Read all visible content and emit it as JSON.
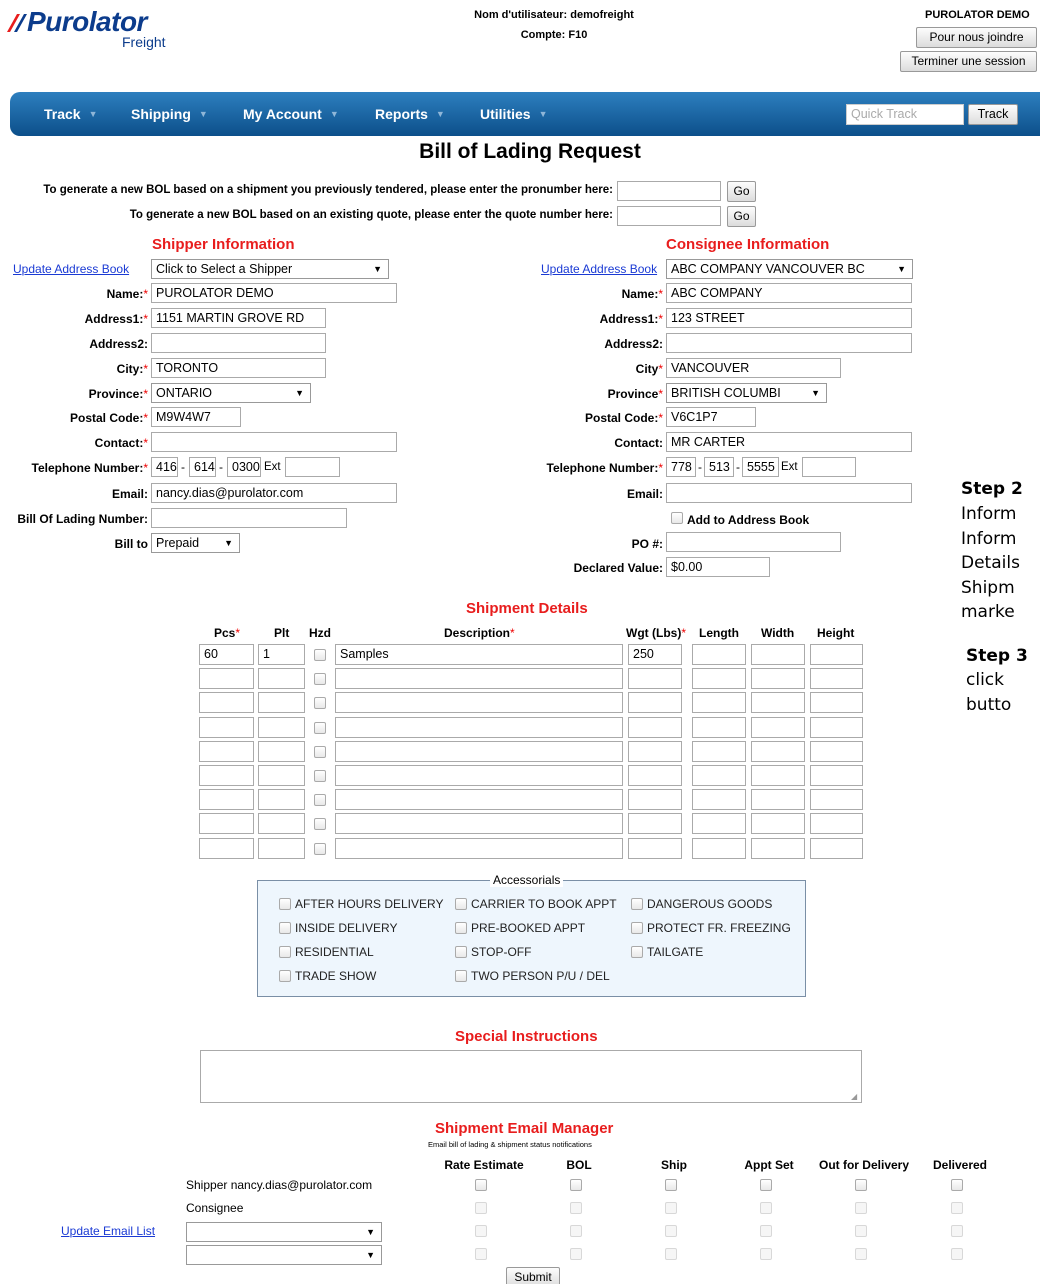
{
  "logo": {
    "brand": "Purolator",
    "sub": "Freight"
  },
  "header": {
    "user_label": "Nom d'utilisateur: demofreight",
    "account_label": "Compte: F10",
    "company": "PUROLATOR DEMO",
    "contact_btn": "Pour nous joindre",
    "logout_btn": "Terminer une session"
  },
  "nav": {
    "items": [
      "Track",
      "Shipping",
      "My Account",
      "Reports",
      "Utilities"
    ],
    "quick_track_placeholder": "Quick Track",
    "track_btn": "Track"
  },
  "page_title": "Bill of Lading Request",
  "generate": {
    "pro_label": "To generate a new BOL based on a shipment you previously tendered, please enter the pronumber here:",
    "quote_label": "To generate a new BOL based on an existing quote, please enter the quote number here:",
    "go": "Go"
  },
  "shipper": {
    "title": "Shipper Information",
    "update_link": "Update Address Book",
    "select": "Click to Select a Shipper",
    "name_label": "Name:",
    "name": "PUROLATOR DEMO",
    "address1_label": "Address1:",
    "address1": "1151 MARTIN GROVE RD",
    "address2_label": "Address2:",
    "city_label": "City:",
    "city": "TORONTO",
    "province_label": "Province:",
    "province": "ONTARIO",
    "postal_label": "Postal Code:",
    "postal": "M9W4W7",
    "contact_label": "Contact:",
    "phone_label": "Telephone Number:",
    "phone1": "416",
    "phone2": "614",
    "phone3": "0300",
    "ext": "Ext",
    "email_label": "Email:",
    "email": "nancy.dias@purolator.com",
    "bol_label": "Bill Of Lading Number:",
    "billto_label": "Bill to",
    "billto": "Prepaid"
  },
  "consignee": {
    "title": "Consignee Information",
    "update_link": "Update Address Book",
    "select": "ABC COMPANY VANCOUVER BC",
    "name_label": "Name:",
    "name": "ABC COMPANY",
    "address1_label": "Address1:",
    "address1": "123 STREET",
    "address2_label": "Address2:",
    "city_label": "City",
    "city": "VANCOUVER",
    "province_label": "Province",
    "province": "BRITISH COLUMBI",
    "postal_label": "Postal Code:",
    "postal": "V6C1P7",
    "contact_label": "Contact:",
    "contact": "MR CARTER",
    "phone_label": "Telephone Number:",
    "phone1": "778",
    "phone2": "513",
    "phone3": "5555",
    "ext": "Ext",
    "email_label": "Email:",
    "add_book_label": "Add to Address Book",
    "po_label": "PO #:",
    "declared_label": "Declared Value:",
    "declared": "$0.00"
  },
  "shipment": {
    "title": "Shipment Details",
    "headers": {
      "pcs": "Pcs",
      "plt": "Plt",
      "hzd": "Hzd",
      "desc": "Description",
      "wgt": "Wgt (Lbs)",
      "length": "Length",
      "width": "Width",
      "height": "Height"
    },
    "row1": {
      "pcs": "60",
      "plt": "1",
      "desc": "Samples",
      "wgt": "250"
    }
  },
  "accessorials": {
    "title": "Accessorials",
    "items": [
      "AFTER HOURS DELIVERY",
      "CARRIER TO BOOK APPT",
      "DANGEROUS GOODS",
      "INSIDE DELIVERY",
      "PRE-BOOKED APPT",
      "PROTECT FR. FREEZING",
      "RESIDENTIAL",
      "STOP-OFF",
      "TAILGATE",
      "TRADE SHOW",
      "TWO PERSON P/U / DEL"
    ]
  },
  "special": {
    "title": "Special Instructions"
  },
  "email_mgr": {
    "title": "Shipment Email Manager",
    "subtitle": "Email bill of lading & shipment status notifications",
    "cols": [
      "Rate Estimate",
      "BOL",
      "Ship",
      "Appt Set",
      "Out for Delivery",
      "Delivered"
    ],
    "shipper_row": "Shipper nancy.dias@purolator.com",
    "consignee_row": "Consignee",
    "update_link": "Update Email List"
  },
  "submit": "Submit",
  "steps": {
    "s2_title": "Step 2",
    "s2_l1": "Inform",
    "s2_l2": "Inform",
    "s2_l3": "Details",
    "s2_l4": "Shipm",
    "s2_l5": "marke",
    "s3_title": "Step 3",
    "s3_l1": "click",
    "s3_l2": "butto"
  },
  "colors": {
    "nav": "#0c4f8a",
    "section": "#e81d1d",
    "link": "#1a3ad4",
    "accessorial_bg": "#eef6fd"
  }
}
